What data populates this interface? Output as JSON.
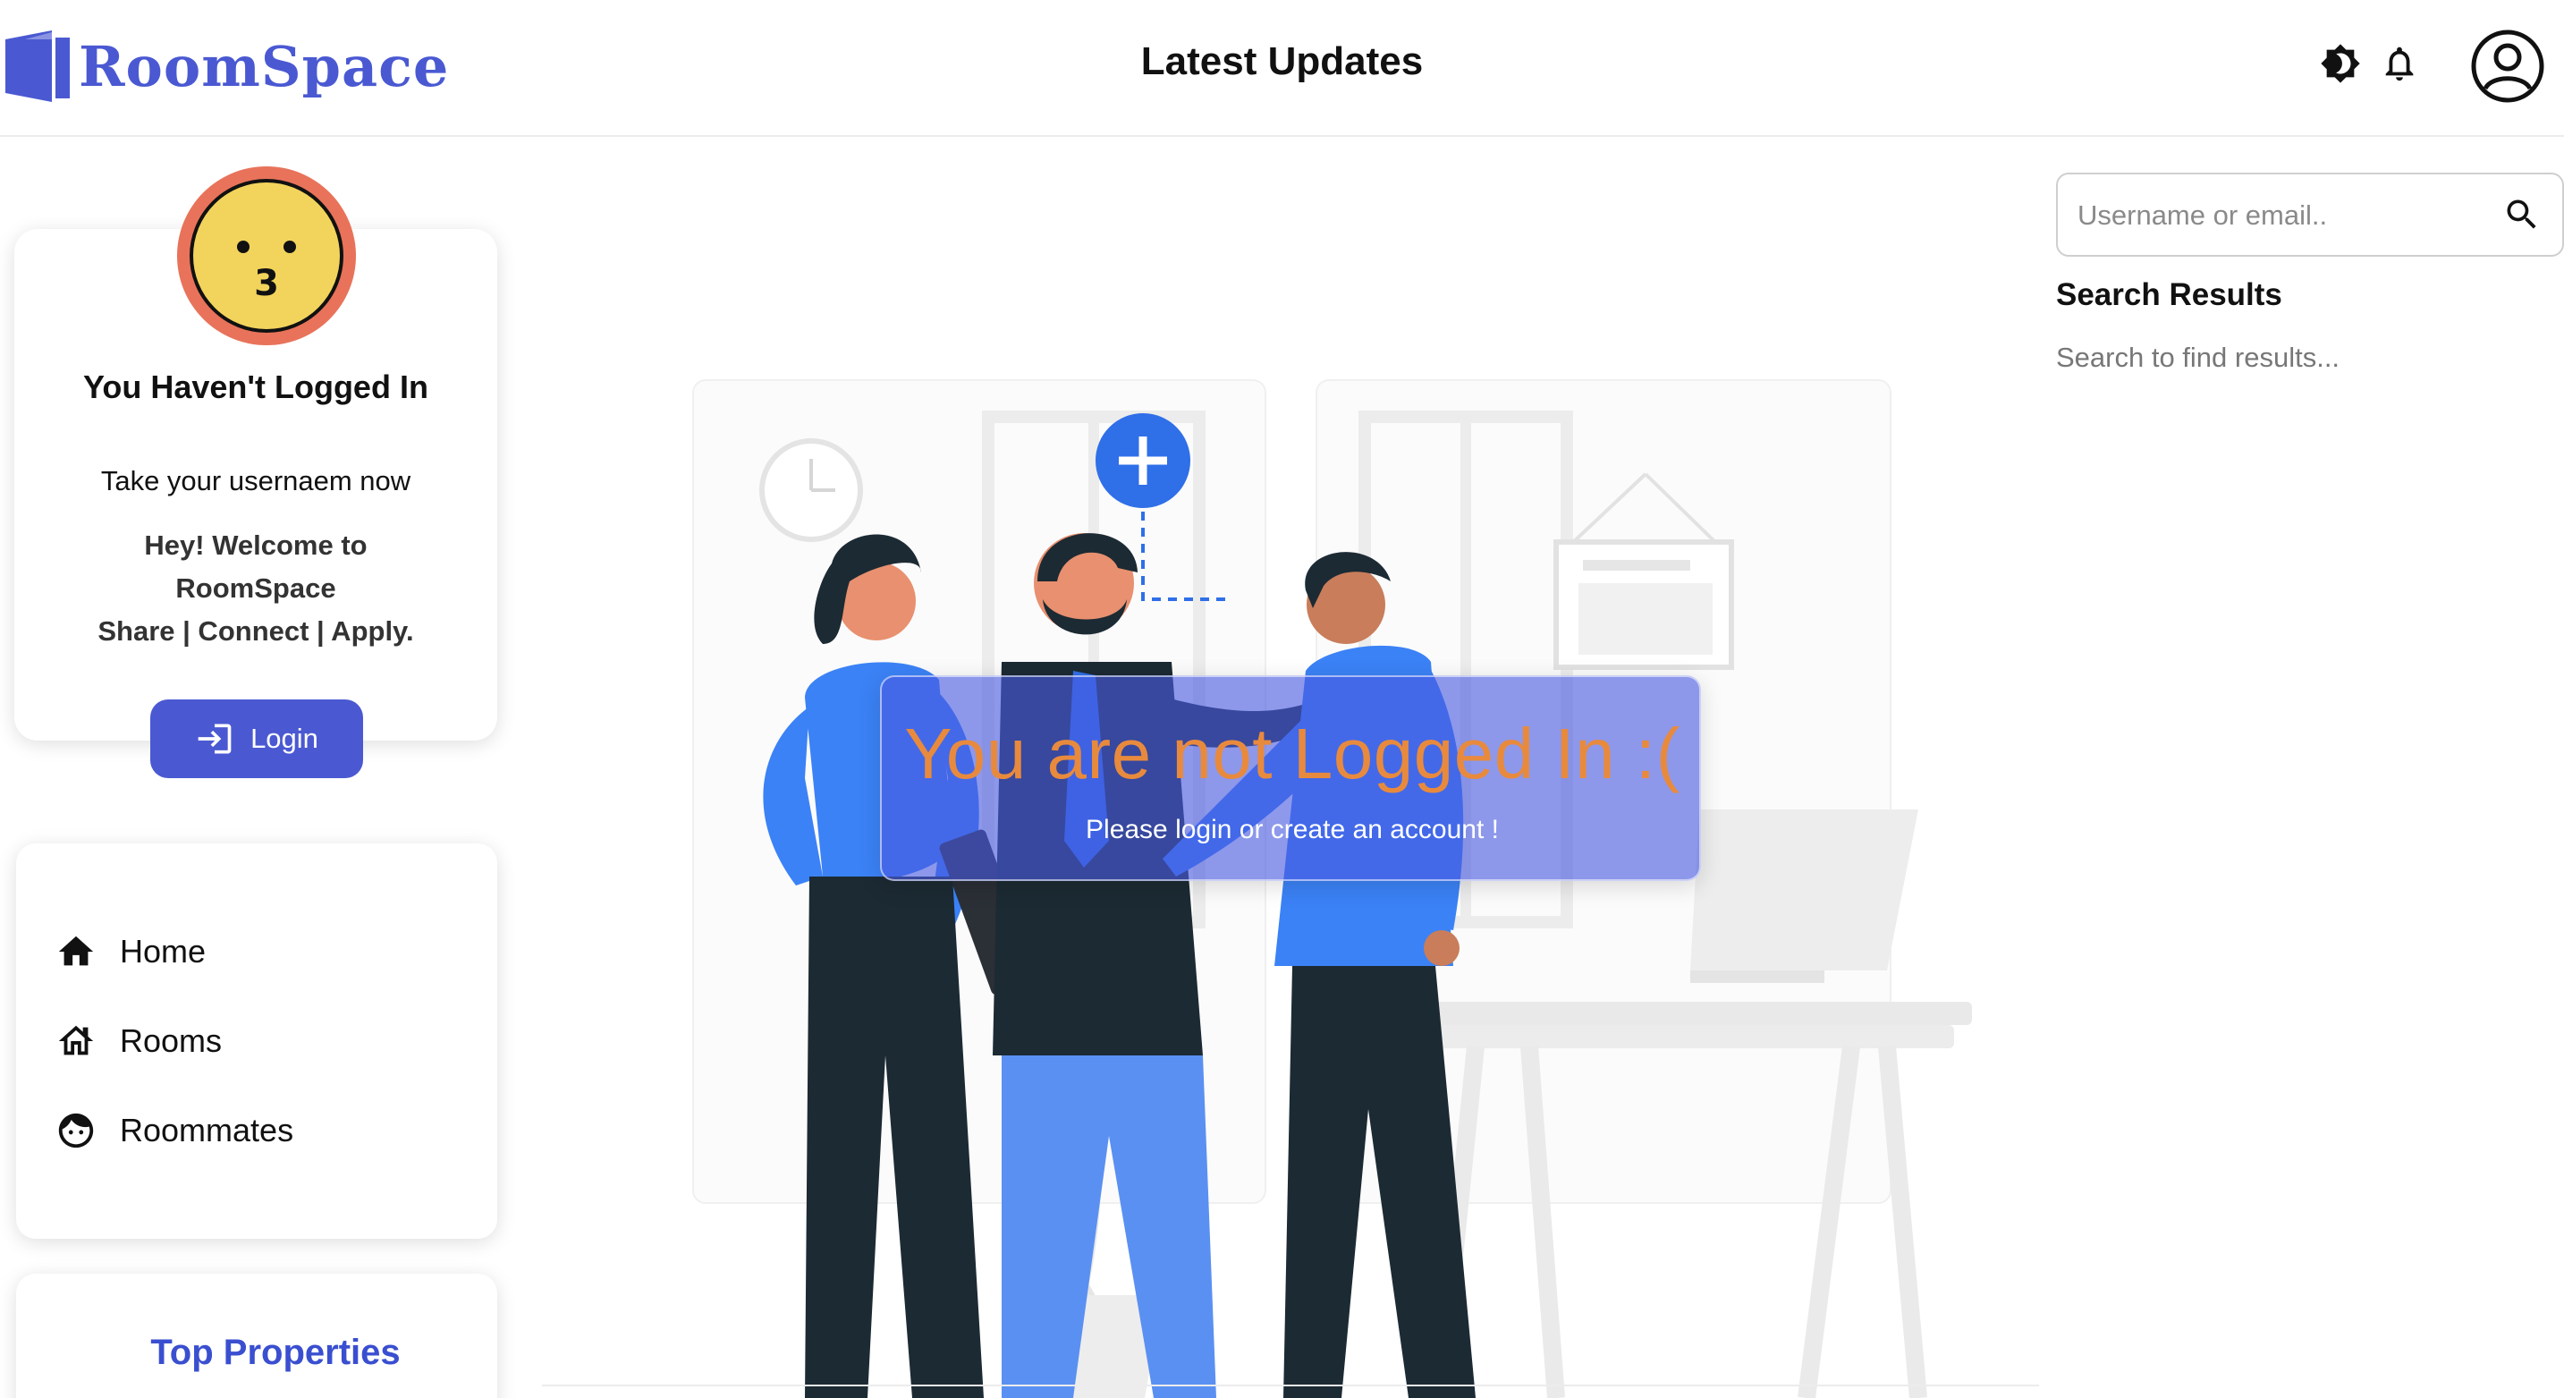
{
  "app": {
    "name": "RoomSpace",
    "page_title": "Latest Updates",
    "accent_color": "#4a59d2"
  },
  "header": {
    "icons": [
      "brightness-icon",
      "bell-icon",
      "account-circle-icon"
    ]
  },
  "profile": {
    "avatar_icon": "kissing-face-icon",
    "title": "You Haven't Logged In",
    "subtitle": "Take your usernaem now",
    "welcome_line1": "Hey! Welcome to",
    "welcome_line2": "RoomSpace",
    "welcome_line3": "Share | Connect | Apply.",
    "login_label": "Login"
  },
  "nav": {
    "items": [
      {
        "label": "Home",
        "icon": "home-icon"
      },
      {
        "label": "Rooms",
        "icon": "house-outline-icon"
      },
      {
        "label": "Roommates",
        "icon": "face-icon"
      }
    ]
  },
  "top_properties": {
    "title": "Top Properties"
  },
  "notice": {
    "title": "You are not Logged In :(",
    "subtitle": "Please login or create an account !",
    "title_color": "#e88a3d"
  },
  "search": {
    "placeholder": "Username or email..",
    "results_title": "Search Results",
    "empty_text": "Search to find results..."
  }
}
